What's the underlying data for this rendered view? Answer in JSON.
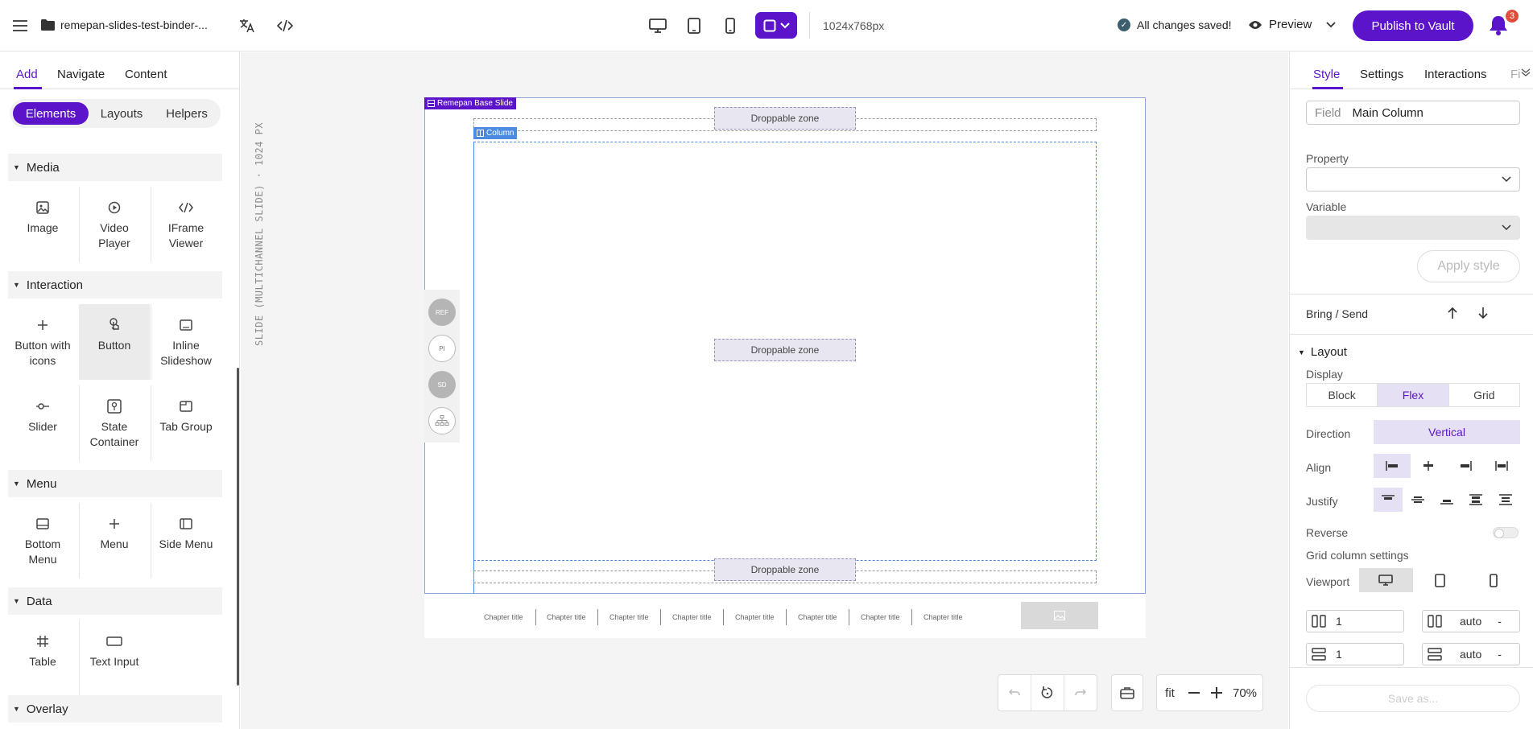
{
  "topbar": {
    "file_title": "remepan-slides-test-binder-...",
    "dimensions": "1024x768px",
    "saved_status": "All changes saved!",
    "preview_label": "Preview",
    "publish_label": "Publish to Vault",
    "notification_count": "3"
  },
  "left": {
    "tabs": [
      "Add",
      "Navigate",
      "Content"
    ],
    "subtabs": [
      "Elements",
      "Layouts",
      "Helpers"
    ],
    "sections": [
      {
        "title": "Media",
        "items": [
          "Image",
          "Video Player",
          "IFrame Viewer"
        ]
      },
      {
        "title": "Interaction",
        "items": [
          "Button with icons",
          "Button",
          "Inline Slideshow",
          "Slider",
          "State Container",
          "Tab Group"
        ]
      },
      {
        "title": "Menu",
        "items": [
          "Bottom Menu",
          "Menu",
          "Side Menu"
        ]
      },
      {
        "title": "Data",
        "items": [
          "Table",
          "Text Input"
        ]
      },
      {
        "title": "Overlay",
        "items": []
      }
    ]
  },
  "canvas": {
    "vertical_label": "SLIDE (MULTICHANNEL SLIDE) · 1024 PX",
    "slide_tag": "Remepan Base Slide",
    "column_tag": "Column",
    "droppable_label": "Droppable zone",
    "side_circles": [
      "REF",
      "PI",
      "SD"
    ],
    "chapters": [
      "Chapter title",
      "Chapter title",
      "Chapter title",
      "Chapter title",
      "Chapter title",
      "Chapter title",
      "Chapter title",
      "Chapter title"
    ],
    "fit_label": "fit",
    "zoom": "70%"
  },
  "right": {
    "tabs": [
      "Style",
      "Settings",
      "Interactions",
      "Fi"
    ],
    "field_label": "Field",
    "field_value": "Main Column",
    "property_label": "Property",
    "variable_label": "Variable",
    "apply_label": "Apply style",
    "bring_send_label": "Bring / Send",
    "layout_title": "Layout",
    "display_label": "Display",
    "display_options": [
      "Block",
      "Flex",
      "Grid"
    ],
    "direction_label": "Direction",
    "direction_value": "Vertical",
    "align_label": "Align",
    "justify_label": "Justify",
    "reverse_label": "Reverse",
    "grid_label": "Grid column settings",
    "viewport_label": "Viewport",
    "grid_col_count": "1",
    "grid_col_size": "auto",
    "grid_row_count": "1",
    "grid_row_size": "auto",
    "stepper_sign": "-",
    "save_as_label": "Save as..."
  }
}
